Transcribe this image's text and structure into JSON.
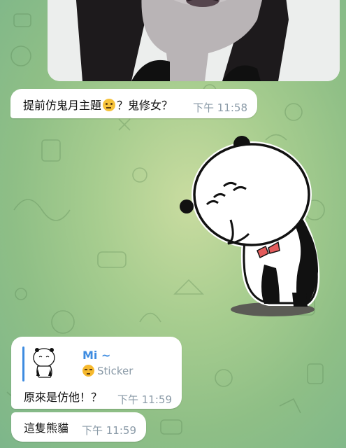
{
  "chat": {
    "messages": [
      {
        "type": "photo",
        "alt": "photo"
      },
      {
        "type": "text",
        "text": "提前仿鬼月主題",
        "text_after_emoji": "？鬼修女？",
        "emoji": "thinking-face",
        "time": "下午 11:58"
      },
      {
        "type": "sticker",
        "description": "panda-sticker"
      },
      {
        "type": "text",
        "reply": {
          "name": "Mi ~",
          "kind": "Sticker",
          "emoji": "pensive-face"
        },
        "text": "原來是仿他！？",
        "time": "下午 11:59"
      },
      {
        "type": "text",
        "text": "這隻熊貓",
        "time": "下午 11:59"
      }
    ]
  },
  "colors": {
    "accent": "#3d8be0",
    "bubble": "#ffffff",
    "time": "#8a9aa7"
  }
}
